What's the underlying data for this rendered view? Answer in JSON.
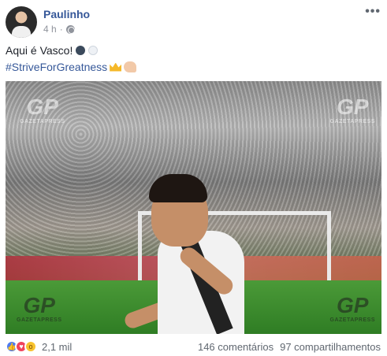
{
  "post": {
    "author": "Paulinho",
    "timestamp": "4 h",
    "privacy_icon": "globe-icon",
    "more_label": "•••",
    "text_line1": "Aqui é Vasco!",
    "hashtag": "#StriveForGreatness",
    "emoji": [
      "black-circle",
      "white-circle",
      "crown",
      "flexed-biceps"
    ],
    "watermark": {
      "logo": "GP",
      "name": "GAZETAPRESS"
    }
  },
  "footer": {
    "reactions": [
      "like-icon",
      "love-icon",
      "wow-icon"
    ],
    "reaction_count": "2,1 mil",
    "comments": "146 comentários",
    "shares": "97 compartilhamentos"
  },
  "colors": {
    "link": "#365899",
    "text": "#1d2129",
    "meta": "#90949c"
  }
}
